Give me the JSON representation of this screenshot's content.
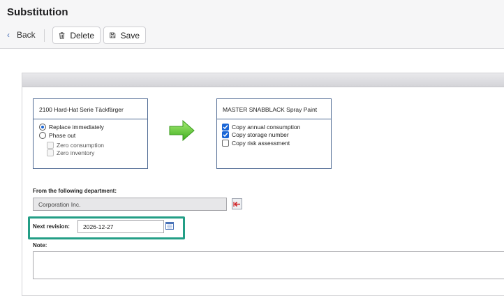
{
  "header": {
    "title": "Substitution",
    "back_label": "Back",
    "delete_label": "Delete",
    "save_label": "Save"
  },
  "source": {
    "product": "2100 Hard-Hat Serie Täckfärger",
    "options": {
      "replace": "Replace immediately",
      "phase_out": "Phase out",
      "zero_consumption": "Zero consumption",
      "zero_inventory": "Zero inventory"
    },
    "selected": "replace"
  },
  "target": {
    "product": "MASTER SNABBLACK Spray Paint",
    "copy_annual": "Copy annual consumption",
    "copy_storage": "Copy storage number",
    "copy_risk": "Copy risk assessment"
  },
  "department": {
    "label": "From the following department:",
    "value": "Corporation Inc."
  },
  "revision": {
    "label": "Next revision:",
    "value": "2026-12-27"
  },
  "note": {
    "label": "Note:",
    "value": ""
  },
  "colors": {
    "accent_highlight": "#239e86",
    "checkbox_blue": "#1a66d6",
    "arrow_green": "#5cc832",
    "box_border": "#4f6a93"
  }
}
